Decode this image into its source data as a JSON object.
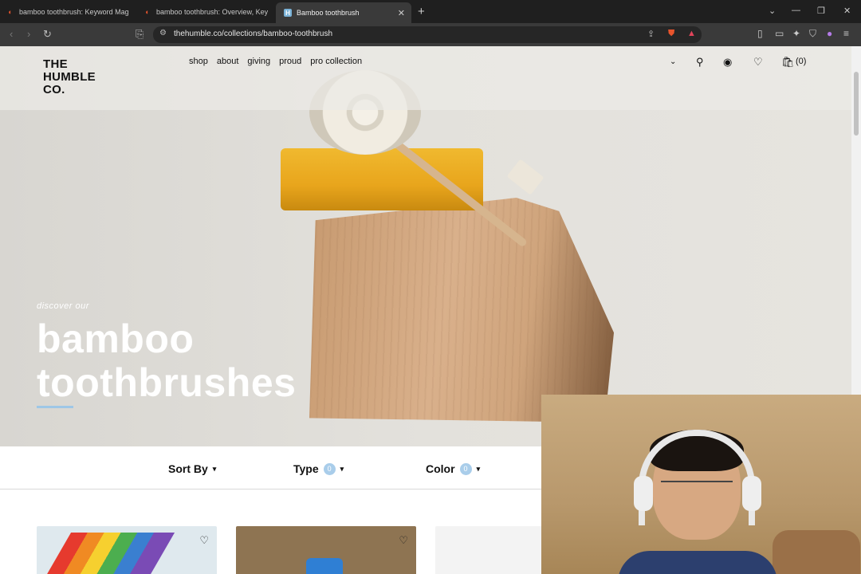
{
  "browser": {
    "tabs": [
      {
        "title": "bamboo toothbrush: Keyword Mag",
        "icon": "semrush-icon",
        "active": false
      },
      {
        "title": "bamboo toothbrush: Overview, Key",
        "icon": "semrush-icon",
        "active": false
      },
      {
        "title": "Bamboo toothbrush",
        "icon": "humble-favicon",
        "active": true
      }
    ],
    "url": "thehumble.co/collections/bamboo-toothbrush"
  },
  "site": {
    "logo": [
      "THE",
      "HUMBLE",
      "CO."
    ],
    "nav": [
      "shop",
      "about",
      "giving",
      "proud",
      "pro collection"
    ],
    "cart_count": "(0)"
  },
  "hero": {
    "eyebrow": "discover our",
    "title_line1": "bamboo",
    "title_line2": "toothbrushes"
  },
  "filters": [
    {
      "label": "Sort By",
      "count": ""
    },
    {
      "label": "Type",
      "count": "0"
    },
    {
      "label": "Color",
      "count": "0"
    }
  ],
  "colors": {
    "accent": "#9ec7e6",
    "tab_bg": "#1f1f1f",
    "toolbar_bg": "#3a3a3a"
  }
}
